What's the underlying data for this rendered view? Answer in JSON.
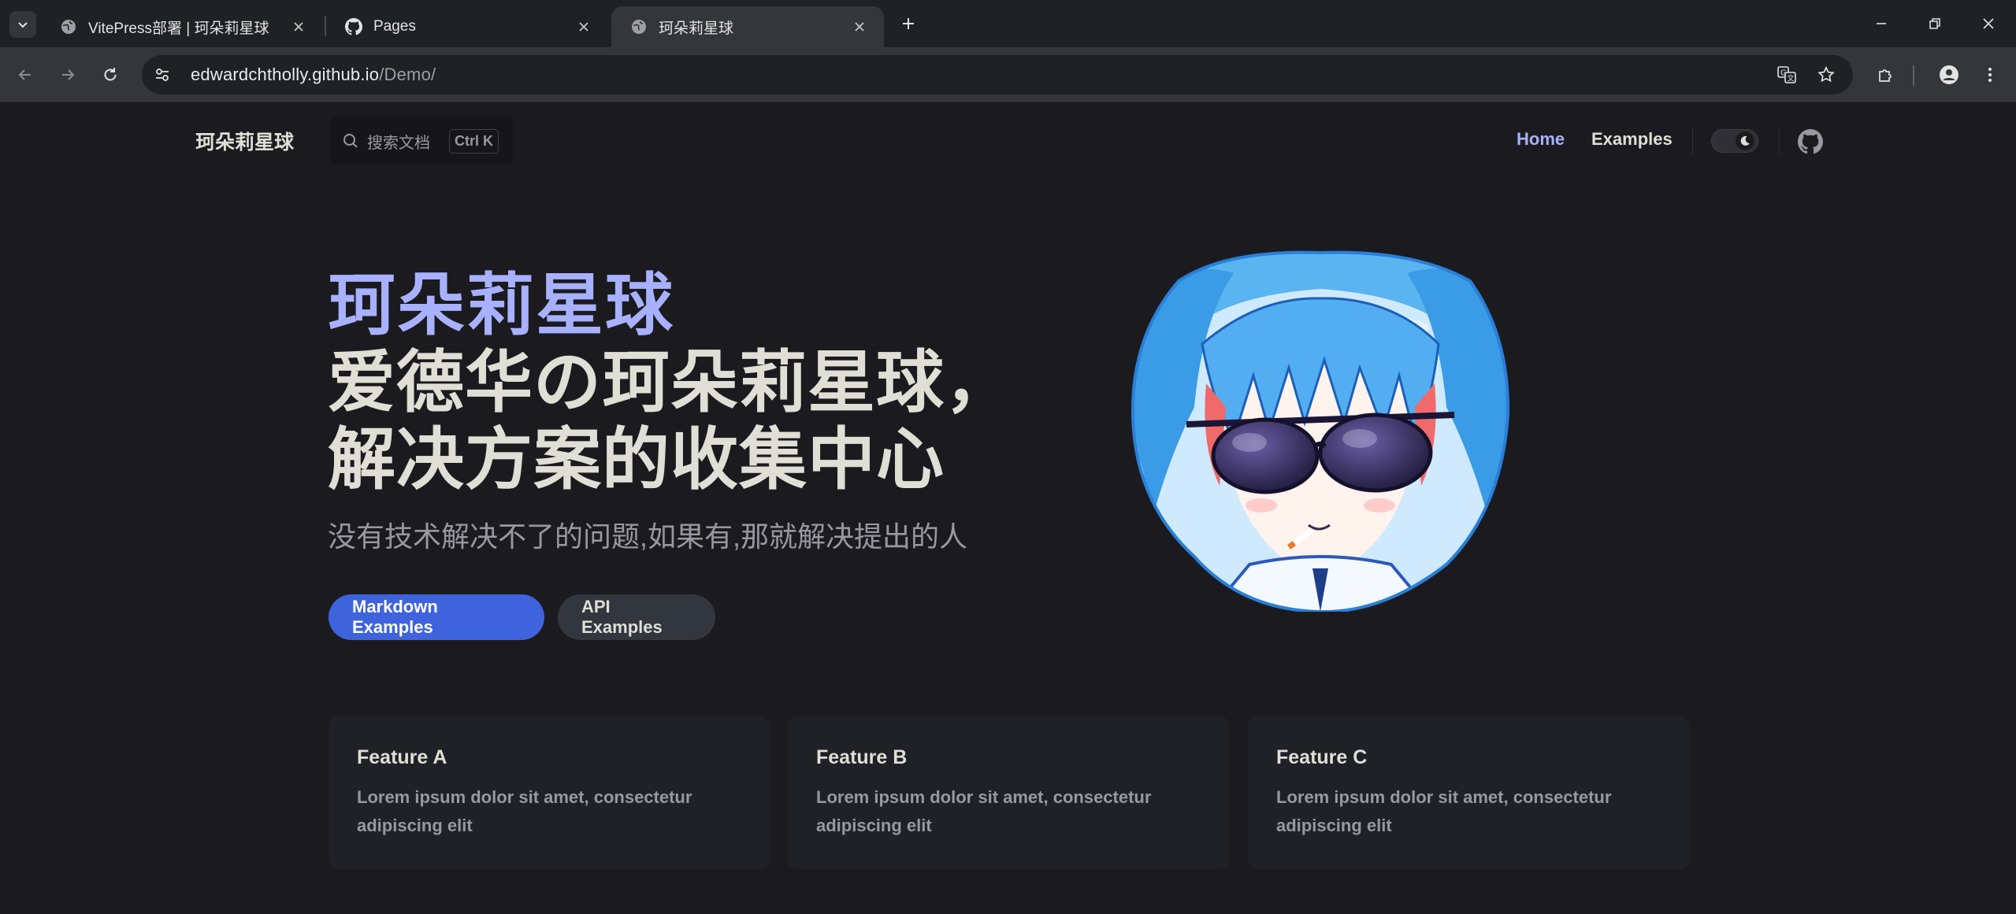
{
  "browser": {
    "tabs": [
      {
        "title": "VitePress部署 | 珂朵莉星球",
        "icon": "globe-icon",
        "active": false
      },
      {
        "title": "Pages",
        "icon": "github-icon",
        "active": false
      },
      {
        "title": "珂朵莉星球",
        "icon": "globe-icon",
        "active": true
      }
    ],
    "url_host": "edwardchtholly.github.io",
    "url_path": "/Demo/"
  },
  "nav": {
    "title": "珂朵莉星球",
    "search_placeholder": "搜索文档",
    "search_shortcut": "Ctrl K",
    "links": [
      {
        "label": "Home",
        "active": true
      },
      {
        "label": "Examples",
        "active": false
      }
    ]
  },
  "hero": {
    "name": "珂朵莉星球",
    "text_line1": "爱德华の珂朵莉星球，",
    "text_line2": "解决方案的收集中心",
    "tagline": "没有技术解决不了的问题,如果有,那就解决提出的人",
    "actions": [
      {
        "label": "Markdown Examples",
        "theme": "brand"
      },
      {
        "label": "API Examples",
        "theme": "alt"
      }
    ]
  },
  "features": [
    {
      "title": "Feature A",
      "details": "Lorem ipsum dolor sit amet, consectetur adipiscing elit"
    },
    {
      "title": "Feature B",
      "details": "Lorem ipsum dolor sit amet, consectetur adipiscing elit"
    },
    {
      "title": "Feature C",
      "details": "Lorem ipsum dolor sit amet, consectetur adipiscing elit"
    }
  ],
  "colors": {
    "brand": "#3e63dd",
    "brand_text": "#a8b1ff",
    "background": "#1b1b1f"
  }
}
